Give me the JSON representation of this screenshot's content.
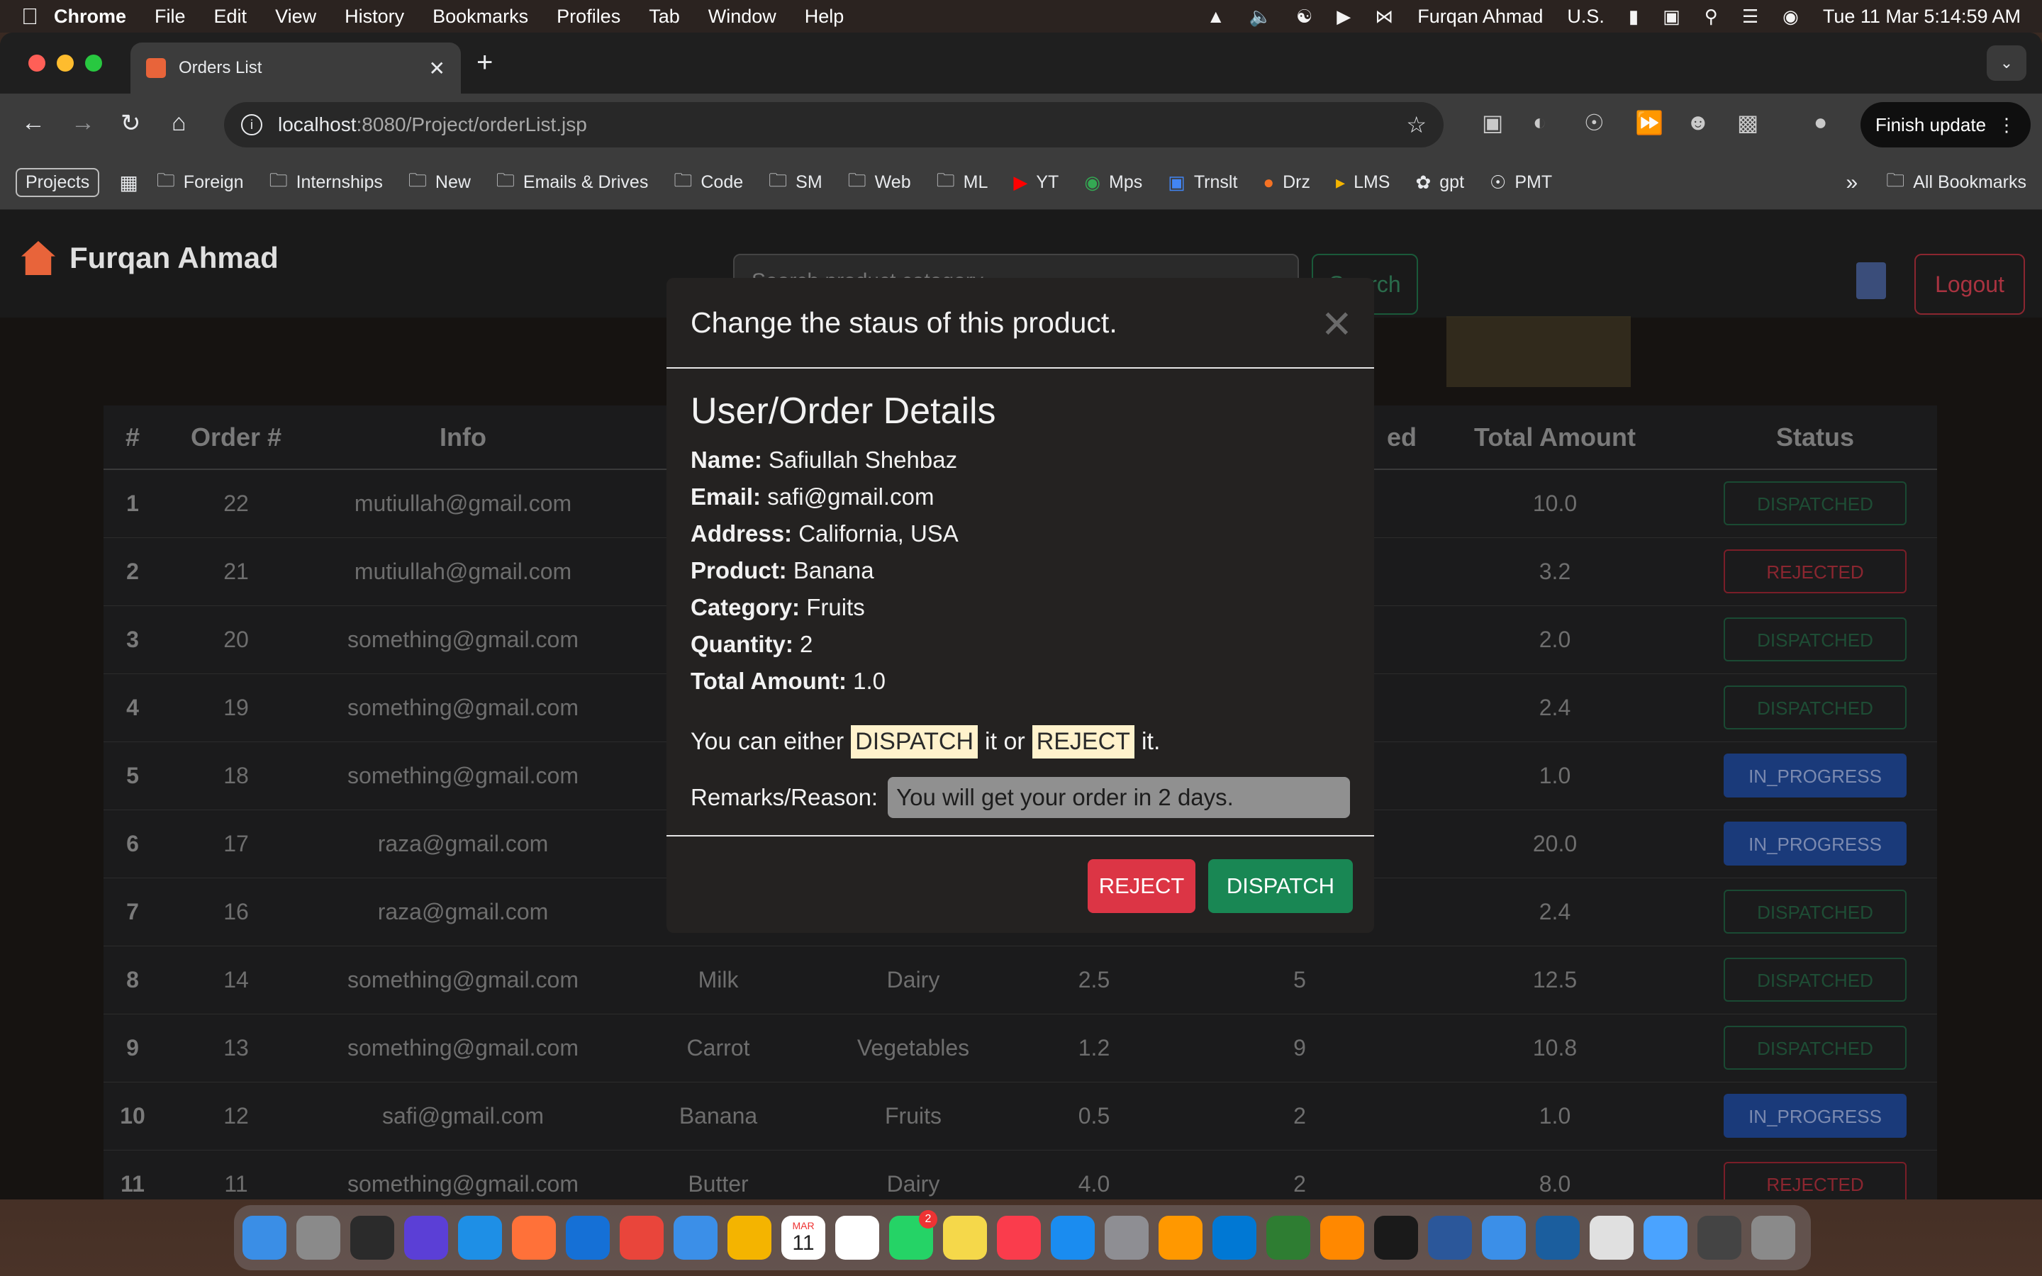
{
  "menubar": {
    "app": "Chrome",
    "items": [
      "File",
      "Edit",
      "View",
      "History",
      "Bookmarks",
      "Profiles",
      "Tab",
      "Window",
      "Help"
    ],
    "user": "Furqan Ahmad",
    "input_source": "U.S.",
    "datetime": "Tue 11 Mar  5:14:59 AM"
  },
  "browser": {
    "tab_title": "Orders List",
    "url_host": "localhost",
    "url_path": ":8080/Project/orderList.jsp",
    "finish_update": "Finish update",
    "bookmarks_projects": "Projects",
    "bookmarks": [
      "Foreign",
      "Internships",
      "New",
      "Emails & Drives",
      "Code",
      "SM",
      "Web",
      "ML",
      "YT",
      "Mps",
      "Trnslt",
      "Drz",
      "LMS",
      "gpt",
      "PMT"
    ],
    "all_bookmarks": "All Bookmarks"
  },
  "page": {
    "brand": "Furqan Ahmad",
    "search_placeholder": "Search product category",
    "search_button": "Search",
    "logout_button": "Logout"
  },
  "table": {
    "headers": [
      "#",
      "Order #",
      "Info",
      "",
      "",
      "",
      "ed",
      "Total Amount",
      "Status"
    ],
    "rows": [
      {
        "idx": "1",
        "order": "22",
        "info": "mutiullah@gmail.com",
        "product": "",
        "category": "",
        "price": "",
        "qty": "",
        "total": "10.0",
        "status": "DISPATCHED"
      },
      {
        "idx": "2",
        "order": "21",
        "info": "mutiullah@gmail.com",
        "product": "",
        "category": "",
        "price": "",
        "qty": "",
        "total": "3.2",
        "status": "REJECTED"
      },
      {
        "idx": "3",
        "order": "20",
        "info": "something@gmail.com",
        "product": "",
        "category": "",
        "price": "",
        "qty": "",
        "total": "2.0",
        "status": "DISPATCHED"
      },
      {
        "idx": "4",
        "order": "19",
        "info": "something@gmail.com",
        "product": "",
        "category": "",
        "price": "",
        "qty": "",
        "total": "2.4",
        "status": "DISPATCHED"
      },
      {
        "idx": "5",
        "order": "18",
        "info": "something@gmail.com",
        "product": "",
        "category": "",
        "price": "",
        "qty": "",
        "total": "1.0",
        "status": "IN_PROGRESS"
      },
      {
        "idx": "6",
        "order": "17",
        "info": "raza@gmail.com",
        "product": "",
        "category": "",
        "price": "",
        "qty": "",
        "total": "20.0",
        "status": "IN_PROGRESS"
      },
      {
        "idx": "7",
        "order": "16",
        "info": "raza@gmail.com",
        "product": "",
        "category": "",
        "price": "",
        "qty": "",
        "total": "2.4",
        "status": "DISPATCHED"
      },
      {
        "idx": "8",
        "order": "14",
        "info": "something@gmail.com",
        "product": "Milk",
        "category": "Dairy",
        "price": "2.5",
        "qty": "5",
        "total": "12.5",
        "status": "DISPATCHED"
      },
      {
        "idx": "9",
        "order": "13",
        "info": "something@gmail.com",
        "product": "Carrot",
        "category": "Vegetables",
        "price": "1.2",
        "qty": "9",
        "total": "10.8",
        "status": "DISPATCHED"
      },
      {
        "idx": "10",
        "order": "12",
        "info": "safi@gmail.com",
        "product": "Banana",
        "category": "Fruits",
        "price": "0.5",
        "qty": "2",
        "total": "1.0",
        "status": "IN_PROGRESS"
      },
      {
        "idx": "11",
        "order": "11",
        "info": "something@gmail.com",
        "product": "Butter",
        "category": "Dairy",
        "price": "4.0",
        "qty": "2",
        "total": "8.0",
        "status": "REJECTED"
      }
    ]
  },
  "modal": {
    "title": "Change the staus of this product.",
    "details_title": "User/Order Details",
    "details": [
      {
        "label": "Name:",
        "value": "Safiullah Shehbaz"
      },
      {
        "label": "Email:",
        "value": "safi@gmail.com"
      },
      {
        "label": "Address:",
        "value": "California, USA"
      },
      {
        "label": "Product:",
        "value": "Banana"
      },
      {
        "label": "Category:",
        "value": "Fruits"
      },
      {
        "label": "Quantity:",
        "value": "2"
      },
      {
        "label": "Total Amount:",
        "value": "1.0"
      }
    ],
    "choice_prefix": "You can either",
    "choice_dispatch": "DISPATCH",
    "choice_middle": "it or",
    "choice_reject": "REJECT",
    "choice_suffix": "it.",
    "remarks_label": "Remarks/Reason:",
    "remarks_value": "You will get your order in 2 days.",
    "reject_button": "REJECT",
    "dispatch_button": "DISPATCH"
  },
  "colors": {
    "reject": "#dc3545",
    "dispatch": "#198754",
    "in_progress": "#1a3a7a"
  },
  "dock_apps": [
    "finder-icon",
    "launchpad-icon",
    "github-icon",
    "arc-icon",
    "safari-icon",
    "firefox-icon",
    "edge-icon",
    "chrome-icon",
    "mail-icon",
    "photos-icon",
    "calendar-icon",
    "reminders-icon",
    "whatsapp-icon",
    "notes-icon",
    "music-icon",
    "appstore-icon",
    "settings-icon",
    "sublime-icon",
    "vscode-icon",
    "classroom-icon",
    "vlc-icon",
    "terminal-icon",
    "word-icon",
    "toolbox-icon",
    "wireshark-icon",
    "archive-icon",
    "folder-icon",
    "screen-icon",
    "trash-icon"
  ],
  "dock_calendar": {
    "month": "MAR",
    "day": "11"
  },
  "dock_whatsapp_badge": "2"
}
